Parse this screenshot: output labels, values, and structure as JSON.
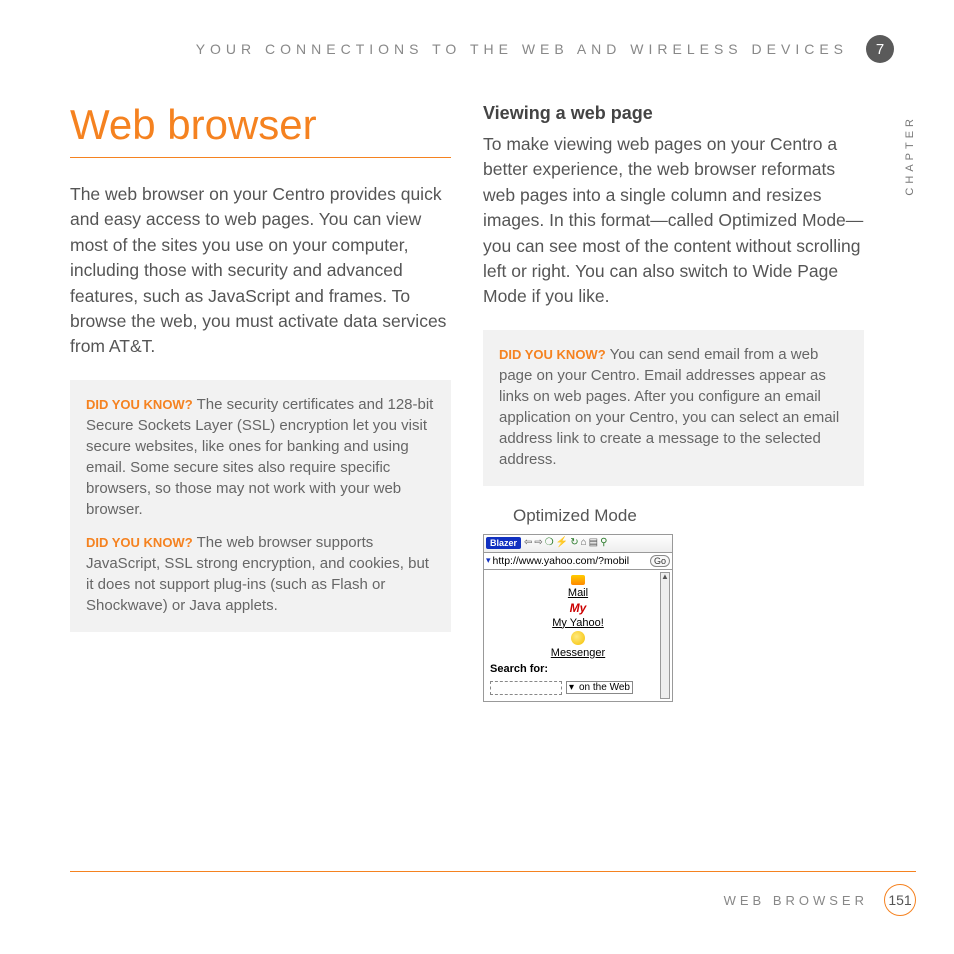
{
  "header": {
    "running_head": "YOUR CONNECTIONS TO THE WEB AND WIRELESS DEVICES",
    "chapter_number": "7",
    "chapter_label": "CHAPTER"
  },
  "left": {
    "title": "Web browser",
    "intro": "The web browser on your Centro provides quick and easy access to web pages. You can view most of the sites you use on your computer, including those with security and advanced features, such as JavaScript and frames. To browse the web, you must activate data services from AT&T.",
    "callout": {
      "label": "DID YOU KNOW?",
      "items": [
        "The security certificates and 128-bit Secure Sockets Layer (SSL) encryption let you visit secure websites, like ones for banking and using email. Some secure sites also require specific browsers, so those may not work with your web browser.",
        "The web browser supports JavaScript, SSL strong encryption, and cookies, but it does not support plug-ins (such as Flash or Shockwave) or Java applets."
      ]
    }
  },
  "right": {
    "subhead": "Viewing a web page",
    "body": "To make viewing web pages on your Centro a better experience, the web browser reformats web pages into a single column and resizes images. In this format—called Optimized Mode—you can see most of the content without scrolling left or right. You can also switch to Wide Page Mode if you like.",
    "callout": {
      "label": "DID YOU KNOW?",
      "text": "You can send email from a web page on your Centro. Email addresses appear as links on web pages. After you configure an email application on your Centro, you can select an email address link to create a message to the selected address."
    },
    "caption": "Optimized Mode",
    "screenshot": {
      "brand": "Blazer",
      "url": "http://www.yahoo.com/?mobil",
      "go": "Go",
      "links": [
        "Mail",
        "My Yahoo!",
        "Messenger"
      ],
      "search_label": "Search for:",
      "dropdown": "on the Web"
    }
  },
  "footer": {
    "section": "WEB BROWSER",
    "page": "151"
  }
}
